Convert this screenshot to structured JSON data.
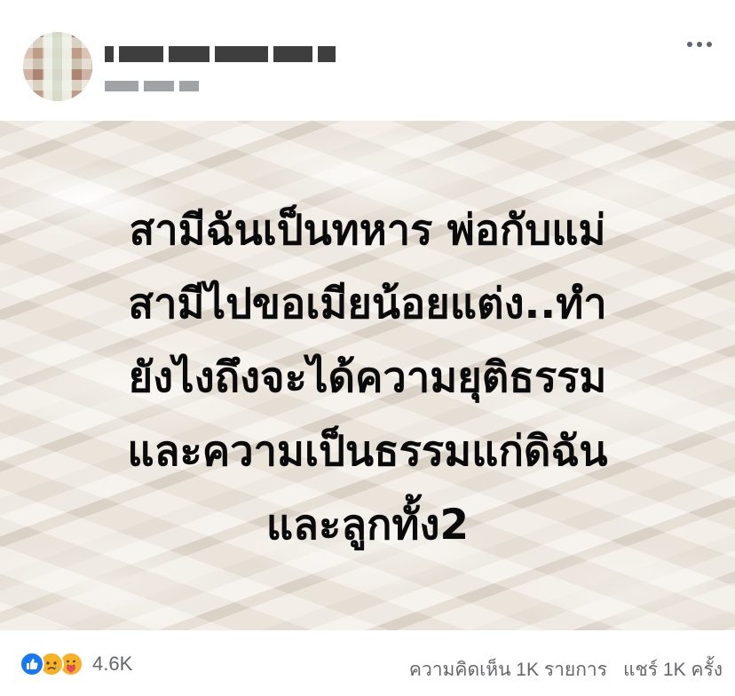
{
  "post": {
    "author_name_blurred": "",
    "timestamp_blurred": "",
    "image_text_lines": [
      "สามีฉันเป็นทหาร พ่อกับแม่",
      "สามีไปขอเมียน้อยแต่ง..ทำ",
      "ยังไงถึงจะได้ความยุติธรรม",
      "และความเป็นธรรมแก่ดิฉัน",
      "และลูกทั้ง2"
    ]
  },
  "footer": {
    "reaction_icons": [
      "like-icon",
      "sad-icon",
      "care-icon"
    ],
    "reaction_count": "4.6K",
    "comments": "ความคิดเห็น 1K รายการ",
    "shares": "แชร์ 1K ครั้ง"
  },
  "colors": {
    "like": "#1877f2",
    "emoji": "#f7b125",
    "meta_text": "#65676b"
  }
}
